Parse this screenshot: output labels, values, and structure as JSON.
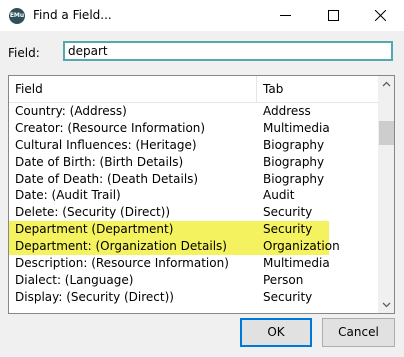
{
  "window": {
    "title": "Find a Field...",
    "app_icon_text": "EMu"
  },
  "search": {
    "label": "Field:",
    "value": "depart"
  },
  "list": {
    "columns": [
      "Field",
      "Tab"
    ],
    "rows": [
      {
        "field": "Country: (Address)",
        "tab": "Address",
        "highlighted": false
      },
      {
        "field": "Creator: (Resource Information)",
        "tab": "Multimedia",
        "highlighted": false
      },
      {
        "field": "Cultural Influences: (Heritage)",
        "tab": "Biography",
        "highlighted": false
      },
      {
        "field": "Date of Birth: (Birth Details)",
        "tab": "Biography",
        "highlighted": false
      },
      {
        "field": "Date of Death: (Death Details)",
        "tab": "Biography",
        "highlighted": false
      },
      {
        "field": "Date: (Audit Trail)",
        "tab": "Audit",
        "highlighted": false
      },
      {
        "field": "Delete: (Security (Direct))",
        "tab": "Security",
        "highlighted": false
      },
      {
        "field": "Department (Department)",
        "tab": "Security",
        "highlighted": true
      },
      {
        "field": "Department: (Organization Details)",
        "tab": "Organization",
        "highlighted": true
      },
      {
        "field": "Description: (Resource Information)",
        "tab": "Multimedia",
        "highlighted": false
      },
      {
        "field": "Dialect: (Language)",
        "tab": "Person",
        "highlighted": false
      },
      {
        "field": "Display: (Security (Direct))",
        "tab": "Security",
        "highlighted": false
      }
    ],
    "highlight_color": "#f4f25e"
  },
  "buttons": {
    "ok": "OK",
    "cancel": "Cancel"
  }
}
